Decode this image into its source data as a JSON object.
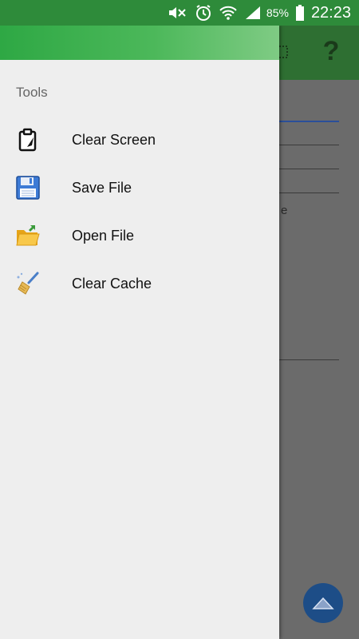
{
  "status_bar": {
    "icons": [
      "mute-icon",
      "alarm-icon",
      "wifi-icon",
      "signal-icon",
      "battery-icon"
    ],
    "battery_percent": "85%",
    "time": "22:23",
    "color": "#2e8b3a"
  },
  "app": {
    "toolbar_color": "#2e6f32",
    "toolbar_icons": [
      "layout-icon",
      "help-icon"
    ],
    "help_label": "?",
    "partial_text": "e"
  },
  "drawer": {
    "section_title": "Tools",
    "items": [
      {
        "label": "Clear Screen",
        "icon": "clipboard-icon"
      },
      {
        "label": "Save File",
        "icon": "floppy-disk-icon"
      },
      {
        "label": "Open File",
        "icon": "folder-open-icon"
      },
      {
        "label": "Clear Cache",
        "icon": "broom-icon"
      }
    ]
  }
}
